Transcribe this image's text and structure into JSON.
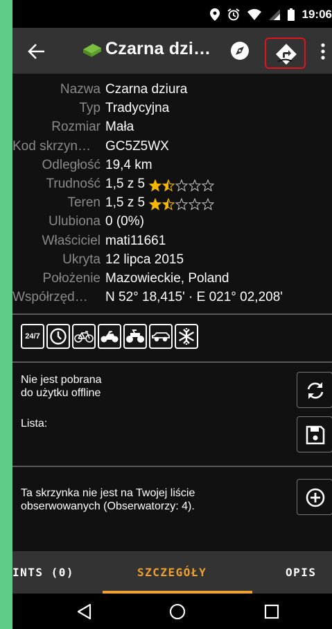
{
  "status_bar": {
    "time": "19:06",
    "icons": [
      "location-icon",
      "alarm-icon",
      "wifi-icon",
      "signal-icon",
      "battery-icon"
    ]
  },
  "app_bar": {
    "title": "Czarna dzi…",
    "icons": [
      "back-arrow-icon",
      "cache-type-icon",
      "compass-icon",
      "navigate-icon",
      "more-vert-icon"
    ]
  },
  "details": [
    {
      "label": "Nazwa",
      "value": "Czarna dziura"
    },
    {
      "label": "Typ",
      "value": "Tradycyjna"
    },
    {
      "label": "Rozmiar",
      "value": "Mała"
    },
    {
      "label": "Kod skrzyn…",
      "value": "GC5Z5WX"
    },
    {
      "label": "Odległość",
      "value": "19,4 km"
    },
    {
      "label": "Trudność",
      "value": "1,5 z 5",
      "stars": 1.5
    },
    {
      "label": "Teren",
      "value": "1,5 z 5",
      "stars": 1.5
    },
    {
      "label": "Ulubiona",
      "value": "0 (0%)"
    },
    {
      "label": "Właściciel",
      "value": "mati11661"
    },
    {
      "label": "Ukryta",
      "value": "12 lipca 2015"
    },
    {
      "label": "Położenie",
      "value": "Mazowieckie, Poland"
    },
    {
      "label": "Współrzęd…",
      "value": "N 52° 18,415' · E 021° 02,208'"
    }
  ],
  "attributes": {
    "label_247": "24/7",
    "icons": [
      "available-24-7-icon",
      "clock-icon",
      "bicycle-icon",
      "motorcycle-icon",
      "quad-icon",
      "offroad-vehicle-icon",
      "snowflake-icon"
    ]
  },
  "offline": {
    "line1": "Nie jest pobrana",
    "line2": "do użytku offline",
    "list_label": "Lista:"
  },
  "watchlist": {
    "line1": "Ta skrzynka nie jest na Twojej liście",
    "line2": "obserwowanych (Obserwatorzy: 4)."
  },
  "tabs": [
    {
      "label": "INTS (0)"
    },
    {
      "label": "SZCZEGÓŁY",
      "active": true
    },
    {
      "label": "OPIS"
    }
  ],
  "colors": {
    "accent": "#f0a030",
    "highlight_box": "#e0141e",
    "star": "#f5b800"
  }
}
